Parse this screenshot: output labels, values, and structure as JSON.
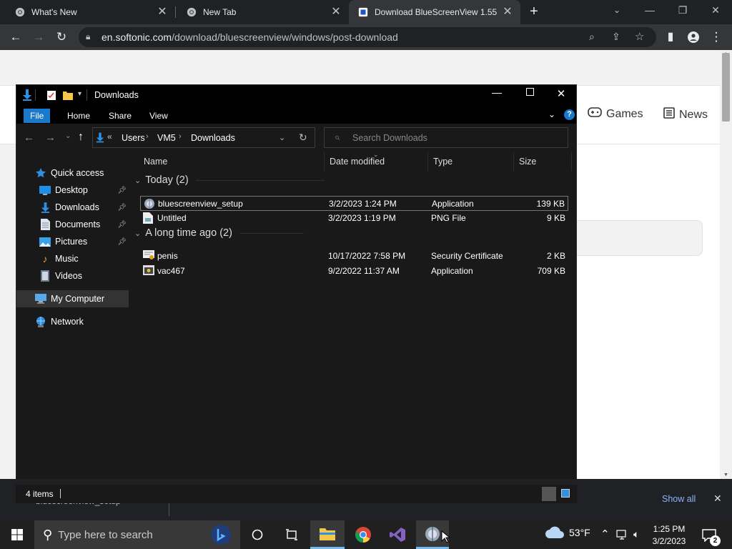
{
  "browser": {
    "tabs": [
      {
        "title": "What's New",
        "icon": "chrome-icon"
      },
      {
        "title": "New Tab",
        "icon": "chrome-icon"
      },
      {
        "title": "Download BlueScreenView 1.55",
        "icon": "softonic-icon"
      }
    ],
    "url_host": "en.softonic.com",
    "url_path": "/download/bluescreenview/windows/post-download"
  },
  "page": {
    "nav": [
      {
        "label": "Games",
        "icon": "gamepad-icon"
      },
      {
        "label": "News",
        "icon": "news-icon"
      }
    ]
  },
  "explorer": {
    "title": "Downloads",
    "ribbon_tabs": [
      "File",
      "Home",
      "Share",
      "View"
    ],
    "breadcrumb": [
      "Users",
      "VM5",
      "Downloads"
    ],
    "breadcrumb_prefix": "«",
    "search_placeholder": "Search Downloads",
    "nav_items": [
      {
        "label": "Quick access",
        "icon": "star-icon",
        "pinned": false
      },
      {
        "label": "Desktop",
        "icon": "desktop-folder-icon",
        "pinned": true
      },
      {
        "label": "Downloads",
        "icon": "downloads-folder-icon",
        "pinned": true
      },
      {
        "label": "Documents",
        "icon": "documents-folder-icon",
        "pinned": true
      },
      {
        "label": "Pictures",
        "icon": "pictures-folder-icon",
        "pinned": true
      },
      {
        "label": "Music",
        "icon": "music-folder-icon",
        "pinned": false
      },
      {
        "label": "Videos",
        "icon": "videos-folder-icon",
        "pinned": false
      },
      {
        "label": "My Computer",
        "icon": "computer-icon",
        "pinned": false
      },
      {
        "label": "Network",
        "icon": "network-icon",
        "pinned": false
      }
    ],
    "columns": [
      "Name",
      "Date modified",
      "Type",
      "Size"
    ],
    "groups": [
      {
        "label": "Today (2)",
        "files": [
          {
            "name": "bluescreenview_setup",
            "date": "3/2/2023 1:24 PM",
            "type": "Application",
            "size": "139 KB",
            "icon": "setup-app-icon",
            "selected": true
          },
          {
            "name": "Untitled",
            "date": "3/2/2023 1:19 PM",
            "type": "PNG File",
            "size": "9 KB",
            "icon": "png-file-icon",
            "selected": false
          }
        ]
      },
      {
        "label": "A long time ago (2)",
        "files": [
          {
            "name": "penis",
            "date": "10/17/2022 7:58 PM",
            "type": "Security Certificate",
            "size": "2 KB",
            "icon": "certificate-icon",
            "selected": false
          },
          {
            "name": "vac467",
            "date": "9/2/2022 11:37 AM",
            "type": "Application",
            "size": "709 KB",
            "icon": "app-icon",
            "selected": false
          }
        ]
      }
    ],
    "status": "4 items"
  },
  "download_bar": {
    "item": "bluescreenview_setup",
    "show_all": "Show all"
  },
  "taskbar": {
    "search_placeholder": "Type here to search",
    "weather": "53°F",
    "time": "1:25 PM",
    "date": "3/2/2023",
    "notifications": "2"
  },
  "colors": {
    "accent": "#1979ca",
    "explorer_bg": "#191919",
    "taskbar": "#202020"
  }
}
